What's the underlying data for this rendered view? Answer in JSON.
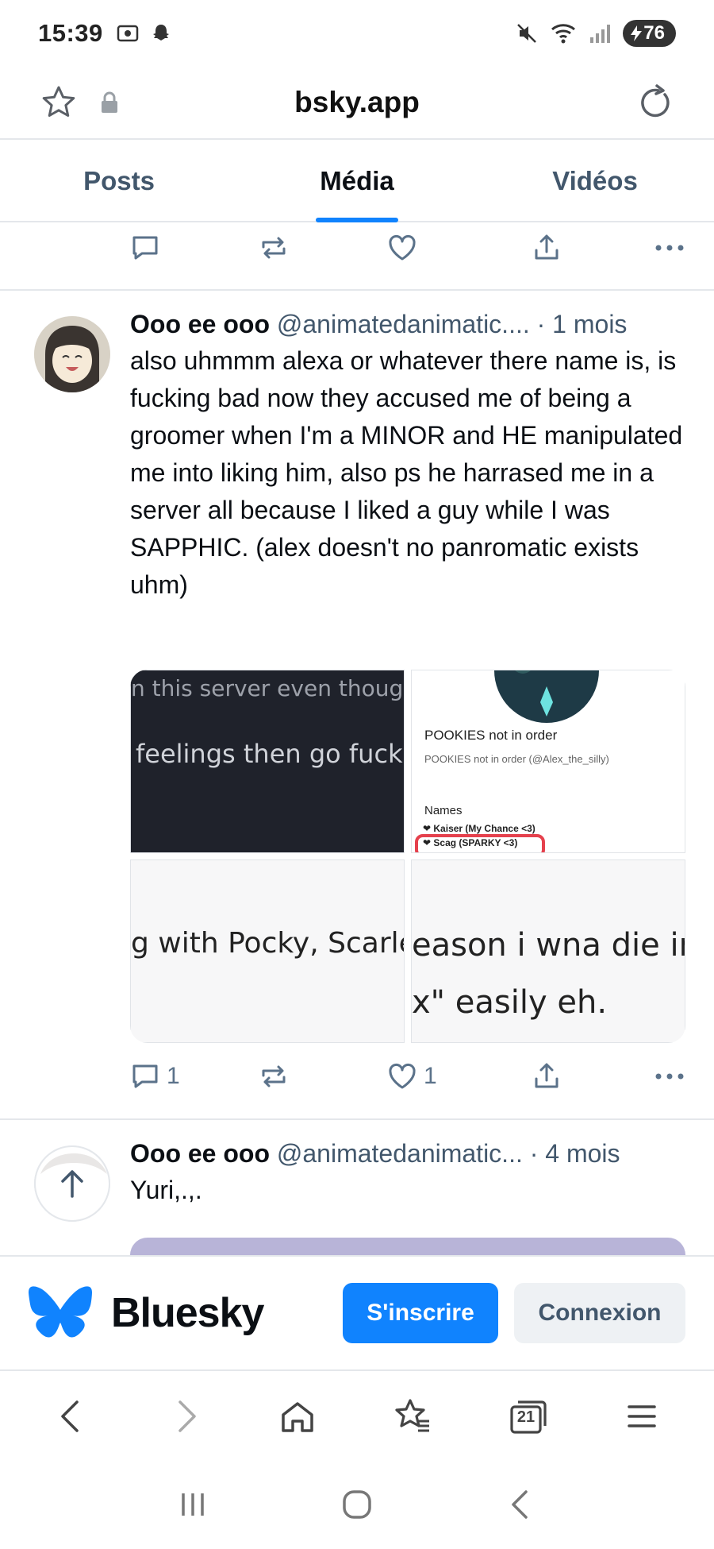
{
  "status_bar": {
    "time": "15:39",
    "battery": "76"
  },
  "browser": {
    "url": "bsky.app"
  },
  "tabs": [
    {
      "label": "Posts"
    },
    {
      "label": "Média"
    },
    {
      "label": "Vidéos"
    }
  ],
  "posts": [
    {
      "author": "Ooo ee ooo",
      "handle": "@animatedanimatic....",
      "time": "· 1 mois",
      "text": "also uhmmm alexa or whatever there name is, is fucking bad now they accused me of being a groomer when I'm a MINOR and HE manipulated me into liking him, also ps he harrased me in a server all because I liked a guy while I was SAPPHIC. (alex doesn't no panromatic exists uhm)",
      "media": {
        "img1_line1": "n this server even though n",
        "img1_line2": "feelings then go fuck y",
        "img2_title": "POOKIES not in order",
        "img2_subtitle": "POOKIES not in order (@Alex_the_silly)",
        "img2_names_label": "Names",
        "img2_name1": "Kaiser (My Chance <3)",
        "img2_name2": "Scag (SPARKY <3)",
        "img3_text": "g with Pocky, Scarle",
        "img4_line1": "eason i wna die in",
        "img4_line2": "x\" easily eh."
      },
      "replies": "1",
      "likes": "1"
    },
    {
      "author": "Ooo ee ooo",
      "handle": "@animatedanimatic...",
      "time": "· 4 mois",
      "text": "Yuri,.,."
    }
  ],
  "banner": {
    "brand": "Bluesky",
    "signup_label": "S'inscrire",
    "login_label": "Connexion"
  },
  "bottom_nav": {
    "tab_count": "21"
  },
  "colors": {
    "accent": "#1083fe",
    "muted": "#5b728a",
    "text": "#0b0f14"
  }
}
